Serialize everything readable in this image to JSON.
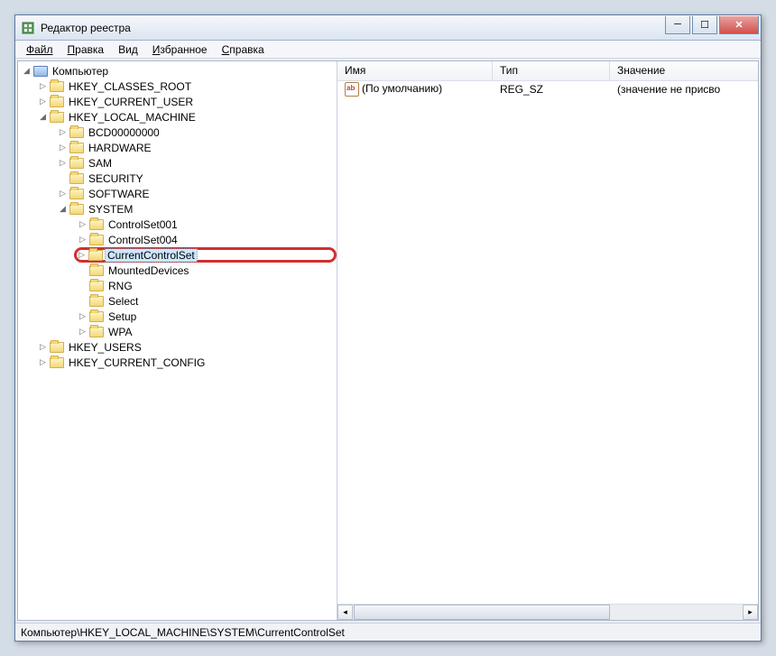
{
  "window": {
    "title": "Редактор реестра"
  },
  "menu": {
    "file": "Файл",
    "edit": "Правка",
    "view": "Вид",
    "favorites": "Избранное",
    "help": "Справка"
  },
  "tree": {
    "root": "Компьютер",
    "hkcr": "HKEY_CLASSES_ROOT",
    "hkcu": "HKEY_CURRENT_USER",
    "hklm": "HKEY_LOCAL_MACHINE",
    "hklm_children": {
      "bcd": "BCD00000000",
      "hardware": "HARDWARE",
      "sam": "SAM",
      "security": "SECURITY",
      "software": "SOFTWARE",
      "system": "SYSTEM"
    },
    "system_children": {
      "cs001": "ControlSet001",
      "cs004": "ControlSet004",
      "ccs": "CurrentControlSet",
      "mounted": "MountedDevices",
      "rng": "RNG",
      "select": "Select",
      "setup": "Setup",
      "wpa": "WPA"
    },
    "hku": "HKEY_USERS",
    "hkcc": "HKEY_CURRENT_CONFIG"
  },
  "columns": {
    "name": "Имя",
    "type": "Тип",
    "data": "Значение"
  },
  "row": {
    "name": "(По умолчанию)",
    "type": "REG_SZ",
    "data": "(значение не присво"
  },
  "status": "Компьютер\\HKEY_LOCAL_MACHINE\\SYSTEM\\CurrentControlSet"
}
